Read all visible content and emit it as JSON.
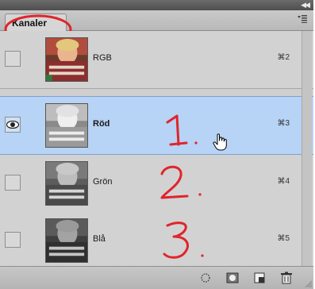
{
  "panel": {
    "tab_label": "Kanaler"
  },
  "channels": [
    {
      "label": "RGB",
      "shortcut": "⌘2",
      "visible": false,
      "selected": false,
      "thumb": "color"
    },
    {
      "label": "Röd",
      "shortcut": "⌘3",
      "visible": true,
      "selected": true,
      "thumb": "gray-light"
    },
    {
      "label": "Grön",
      "shortcut": "⌘4",
      "visible": false,
      "selected": false,
      "thumb": "gray"
    },
    {
      "label": "Blå",
      "shortcut": "⌘5",
      "visible": false,
      "selected": false,
      "thumb": "gray-dark"
    }
  ],
  "annotations": {
    "num1": "1.",
    "num2": "2.",
    "num3": "3."
  },
  "toolbar": {
    "icons": [
      "load-selection-icon",
      "save-selection-icon",
      "new-channel-icon",
      "trash-icon"
    ]
  },
  "colors": {
    "selected_row": "#b7d3f5",
    "annotation_red": "#e0242c",
    "panel_bg": "#d2d2d2"
  }
}
